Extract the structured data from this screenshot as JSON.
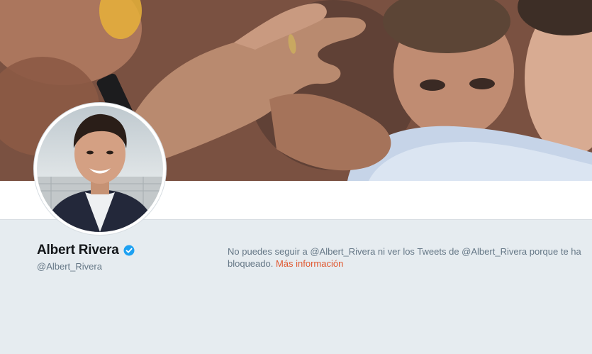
{
  "profile": {
    "name": "Albert Rivera",
    "handle": "@Albert_Rivera",
    "verified": true
  },
  "blocked_notice": {
    "message": "No puedes seguir a @Albert_Rivera ni ver los Tweets de @Albert_Rivera porque te ha bloqueado. ",
    "link_label": "Más información"
  },
  "colors": {
    "accent_link": "#e0572f",
    "verified_badge": "#1da1f2",
    "background": "#e6ecf0",
    "name_text": "#14171a",
    "secondary_text": "#657786"
  },
  "icons": {
    "verified": "verified-badge-icon"
  }
}
